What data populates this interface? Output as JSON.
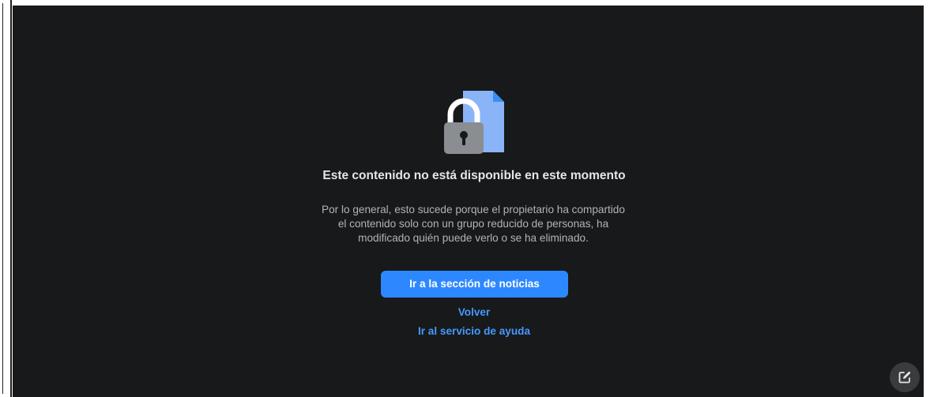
{
  "page": {
    "background": "#18191a",
    "accent": "#2d88ff",
    "link_color": "#4599ff"
  },
  "illustration": {
    "icon": "locked-document-icon"
  },
  "message": {
    "title": "Este contenido no está disponible en este momento",
    "body": "Por lo general, esto sucede porque el propietario ha compartido el contenido solo con un grupo reducido de personas, ha modificado quién puede verlo o se ha eliminado."
  },
  "actions": {
    "primary_label": "Ir a la sección de noticias",
    "back_label": "Volver",
    "help_label": "Ir al servicio de ayuda"
  },
  "fab": {
    "icon": "compose-icon"
  }
}
